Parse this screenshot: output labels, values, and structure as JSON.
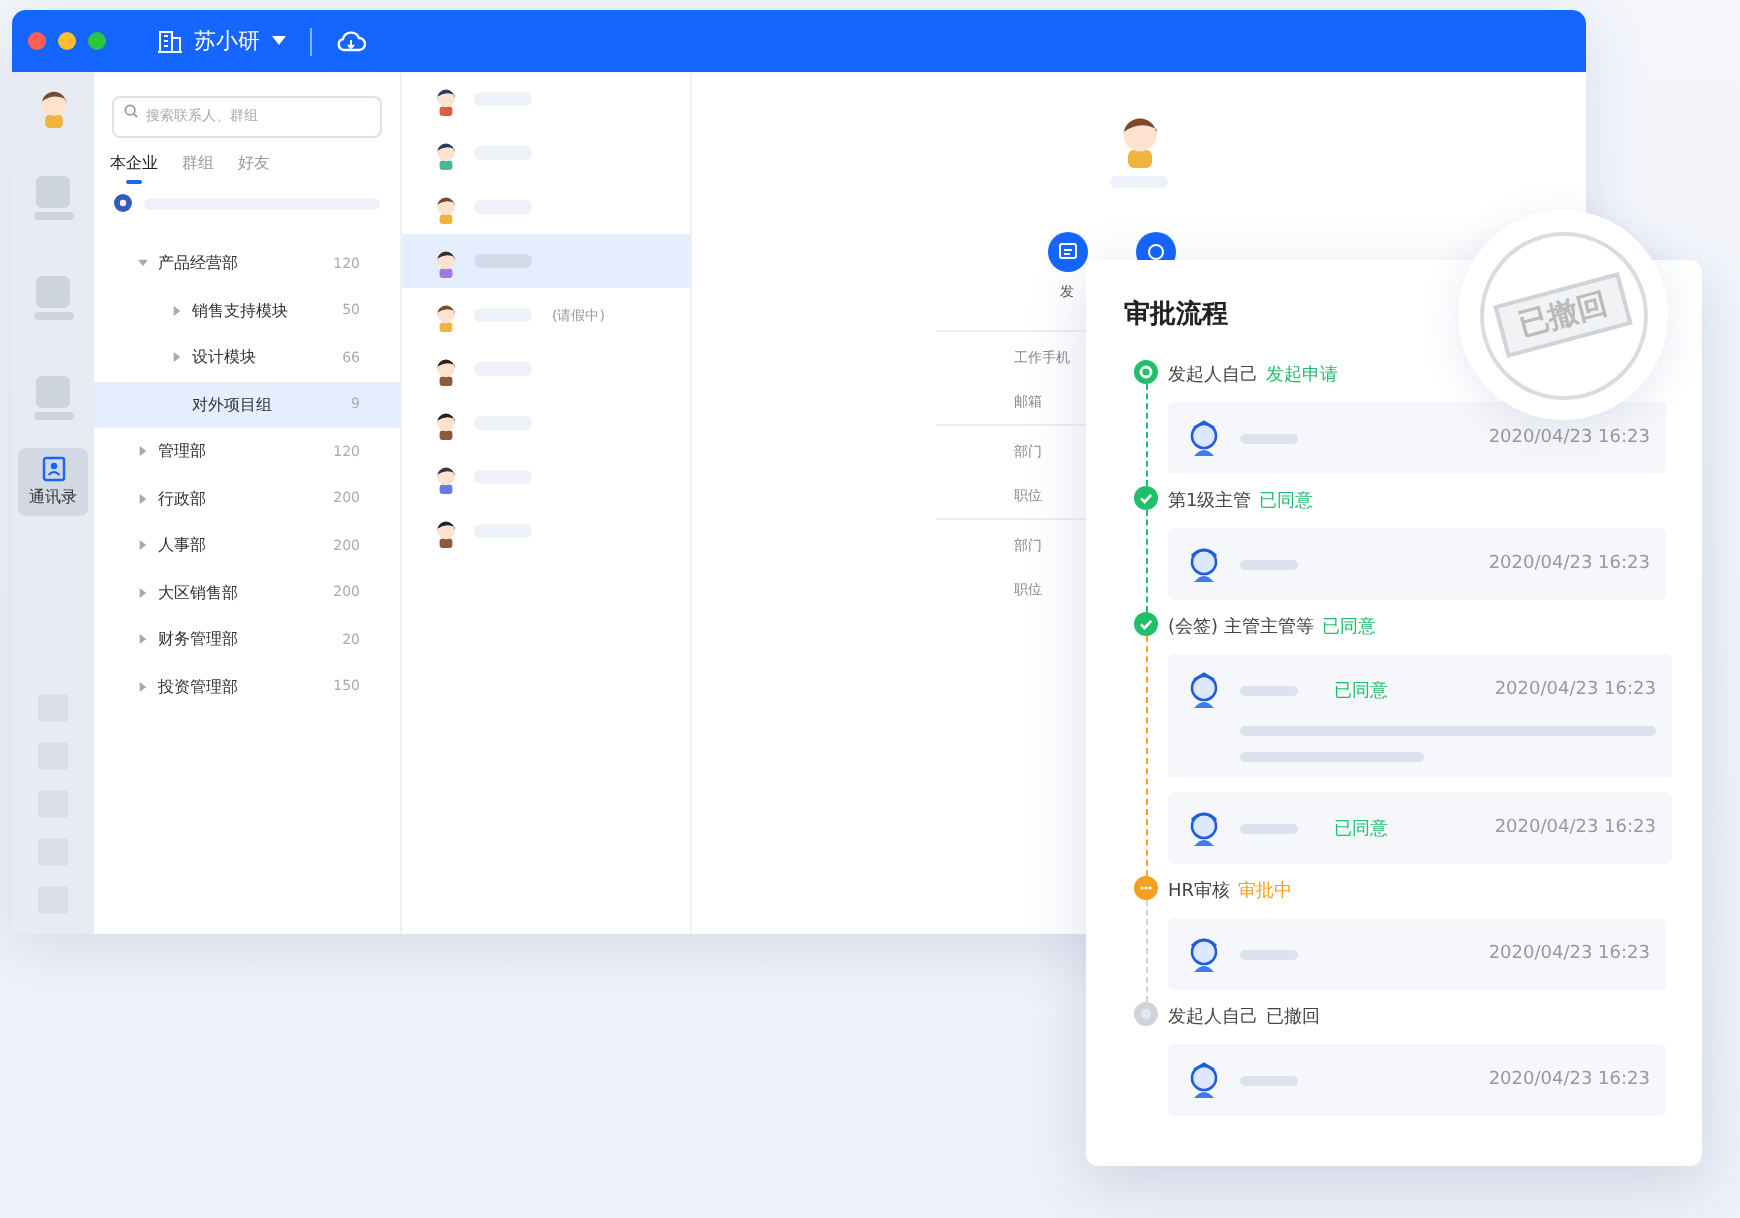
{
  "window": {
    "title": "苏小研"
  },
  "rail": {
    "items": [
      {
        "kind": "blank",
        "selected": false
      },
      {
        "kind": "blank",
        "selected": false
      },
      {
        "kind": "blank",
        "selected": false
      },
      {
        "kind": "contacts",
        "label": "通讯录",
        "selected": true
      }
    ]
  },
  "search": {
    "placeholder": "搜索联系人、群组"
  },
  "tabs": [
    {
      "label": "本企业",
      "selected": true
    },
    {
      "label": "群组",
      "selected": false
    },
    {
      "label": "好友",
      "selected": false
    }
  ],
  "tree": [
    {
      "label": "产品经营部",
      "count": "120",
      "expanded": true,
      "selected": false,
      "children": [
        {
          "label": "销售支持模块",
          "count": "50",
          "expanded": false,
          "selected": false
        },
        {
          "label": "设计模块",
          "count": "66",
          "expanded": false,
          "selected": false
        },
        {
          "label": "对外项目组",
          "count": "9",
          "selected": true
        }
      ]
    },
    {
      "label": "管理部",
      "count": "120",
      "expanded": false,
      "selected": false
    },
    {
      "label": "行政部",
      "count": "200",
      "expanded": false,
      "selected": false
    },
    {
      "label": "人事部",
      "count": "200",
      "expanded": false,
      "selected": false
    },
    {
      "label": "大区销售部",
      "count": "200",
      "expanded": false,
      "selected": false
    },
    {
      "label": "财务管理部",
      "count": "20",
      "expanded": false,
      "selected": false
    },
    {
      "label": "投资管理部",
      "count": "150",
      "expanded": false,
      "selected": false
    }
  ],
  "contacts": [
    {
      "selected": false
    },
    {
      "selected": false
    },
    {
      "selected": false
    },
    {
      "selected": true
    },
    {
      "selected": false,
      "note": "(请假中)"
    },
    {
      "selected": false
    },
    {
      "selected": false
    },
    {
      "selected": false
    },
    {
      "selected": false
    }
  ],
  "detail": {
    "action_label": "发",
    "sections": [
      {
        "fields": [
          "工作手机",
          "邮箱"
        ]
      },
      {
        "fields": [
          "部门",
          "职位"
        ]
      },
      {
        "fields": [
          "部门",
          "职位"
        ]
      }
    ]
  },
  "approval": {
    "title": "审批流程",
    "stamp": "已撤回",
    "steps": [
      {
        "kind": "start",
        "actor": "发起人自己",
        "status": "发起申请",
        "entries": [
          {
            "time": "2020/04/23 16:23",
            "has_comment": false
          }
        ]
      },
      {
        "kind": "done",
        "actor": "第1级主管",
        "status": "已同意",
        "entries": [
          {
            "time": "2020/04/23 16:23",
            "has_comment": false
          }
        ]
      },
      {
        "kind": "done",
        "actor": "(会签) 主管主管等",
        "status": "已同意",
        "entries": [
          {
            "status": "已同意",
            "time": "2020/04/23 16:23",
            "has_comment": true
          },
          {
            "status": "已同意",
            "time": "2020/04/23 16:23",
            "has_comment": false
          }
        ]
      },
      {
        "kind": "pending",
        "actor": "HR审核",
        "status": "审批中",
        "entries": [
          {
            "time": "2020/04/23 16:23",
            "has_comment": false
          }
        ]
      },
      {
        "kind": "revoked",
        "actor": "发起人自己",
        "status": "已撤回",
        "entries": [
          {
            "time": "2020/04/23 16:23",
            "has_comment": false
          }
        ]
      }
    ]
  }
}
